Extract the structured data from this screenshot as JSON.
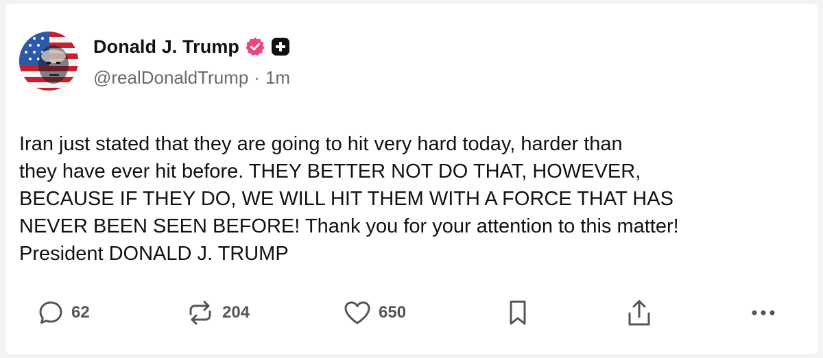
{
  "post": {
    "author": {
      "display_name": "Donald J. Trump",
      "handle": "@realDonaldTrump",
      "separator": "·",
      "time_ago": "1m",
      "verified_badge_icon": "verified-badge-icon",
      "follow_icon": "plus-square-icon"
    },
    "text": "Iran just stated that they are going to hit very hard today, harder than\nthey have ever hit before. THEY BETTER NOT DO THAT, HOWEVER,\nBECAUSE IF THEY DO, WE WILL HIT THEM WITH A FORCE THAT HAS\nNEVER BEEN SEEN BEFORE! Thank you for your attention to this matter!\nPresident DONALD J. TRUMP",
    "actions": {
      "reply_count": "62",
      "repost_count": "204",
      "like_count": "650"
    }
  },
  "colors": {
    "verified_badge": "#e8477f",
    "text": "#111111",
    "secondary_text": "#6b6b6b",
    "icon": "#555555"
  }
}
